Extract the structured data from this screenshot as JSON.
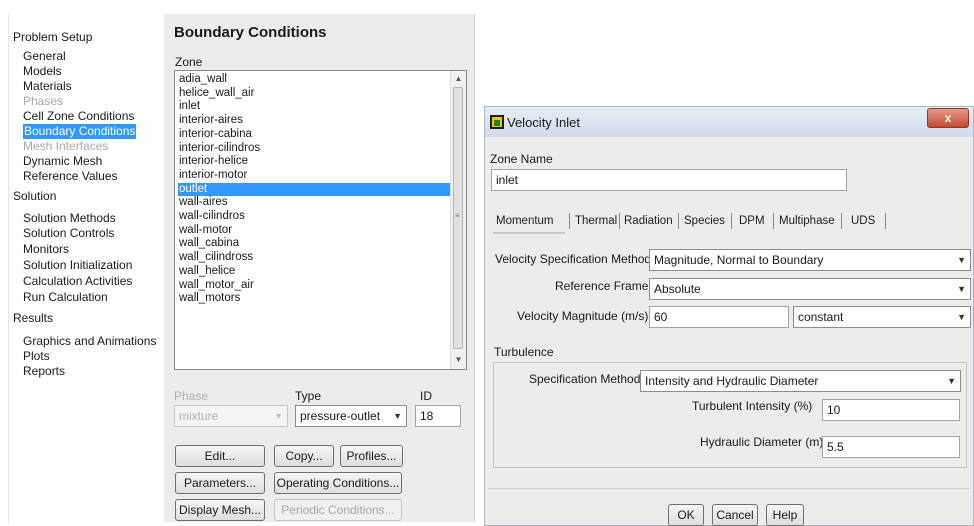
{
  "tree": {
    "problem_setup": "Problem Setup",
    "general": "General",
    "models": "Models",
    "materials": "Materials",
    "phases": "Phases",
    "cell_zone_conditions": "Cell Zone Conditions",
    "boundary_conditions": "Boundary Conditions",
    "mesh_interfaces": "Mesh Interfaces",
    "dynamic_mesh": "Dynamic Mesh",
    "reference_values": "Reference Values",
    "solution": "Solution",
    "solution_methods": "Solution Methods",
    "solution_controls": "Solution Controls",
    "monitors": "Monitors",
    "solution_initialization": "Solution Initialization",
    "calculation_activities": "Calculation Activities",
    "run_calculation": "Run Calculation",
    "results": "Results",
    "graphics_and_animations": "Graphics and Animations",
    "plots": "Plots",
    "reports": "Reports"
  },
  "bc_panel": {
    "title": "Boundary Conditions",
    "zone_label": "Zone",
    "zones": [
      "adia_wall",
      "helice_wall_air",
      "inlet",
      "interior-aires",
      "interior-cabina",
      "interior-cilindros",
      "interior-helice",
      "interior-motor",
      "outlet",
      "wall-aires",
      "wall-cilindros",
      "wall-motor",
      "wall_cabina",
      "wall_cilindross",
      "wall_helice",
      "wall_motor_air",
      "wall_motors"
    ],
    "selected_zone": "outlet",
    "phase_label": "Phase",
    "phase_value": "mixture",
    "type_label": "Type",
    "type_value": "pressure-outlet",
    "id_label": "ID",
    "id_value": "18",
    "edit_button": "Edit...",
    "copy_button": "Copy...",
    "profiles_button": "Profiles...",
    "parameters_button": "Parameters...",
    "operating_conditions_button": "Operating Conditions...",
    "display_mesh_button": "Display Mesh...",
    "periodic_conditions_button": "Periodic Conditions..."
  },
  "dialog": {
    "title": "Velocity Inlet",
    "close": "x",
    "zone_name_label": "Zone Name",
    "zone_name_value": "inlet",
    "tabs": [
      "Momentum",
      "Thermal",
      "Radiation",
      "Species",
      "DPM",
      "Multiphase",
      "UDS"
    ],
    "velocity_spec_label": "Velocity Specification Method",
    "velocity_spec_value": "Magnitude, Normal to Boundary",
    "reference_frame_label": "Reference Frame",
    "reference_frame_value": "Absolute",
    "velocity_magnitude_label": "Velocity Magnitude (m/s)",
    "velocity_magnitude_value": "60",
    "velocity_magnitude_mode": "constant",
    "turbulence_label": "Turbulence",
    "turb_spec_label": "Specification Method",
    "turb_spec_value": "Intensity and Hydraulic Diameter",
    "turb_intensity_label": "Turbulent Intensity (%)",
    "turb_intensity_value": "10",
    "hydraulic_diameter_label": "Hydraulic Diameter (m)",
    "hydraulic_diameter_value": "5.5",
    "ok": "OK",
    "cancel": "Cancel",
    "help": "Help"
  }
}
